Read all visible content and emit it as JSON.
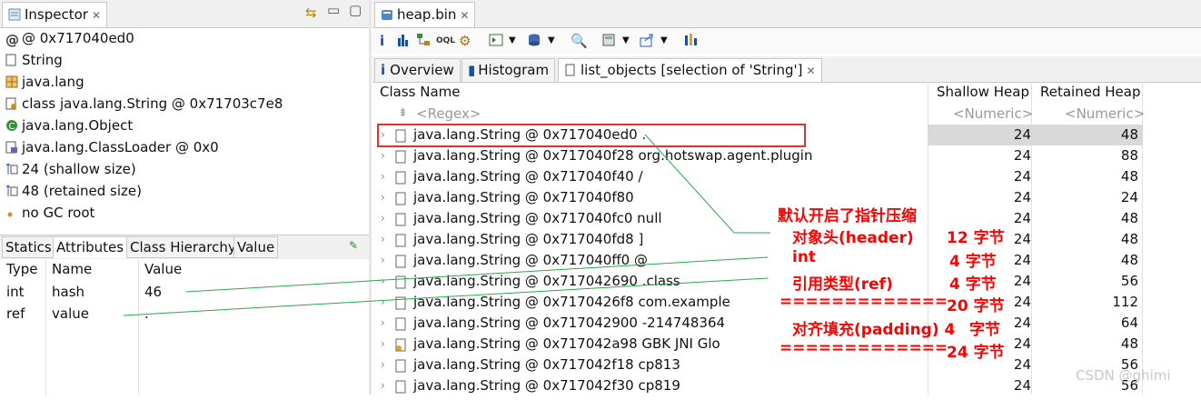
{
  "inspector": {
    "tab_title": "Inspector",
    "rows": [
      {
        "icon": "at-icon",
        "text": "@ 0x717040ed0"
      },
      {
        "icon": "file-icon",
        "text": "String"
      },
      {
        "icon": "package-icon",
        "text": "java.lang"
      },
      {
        "icon": "class-icon",
        "text": "class java.lang.String @ 0x71703c7e8"
      },
      {
        "icon": "superclass-icon",
        "text": "java.lang.Object"
      },
      {
        "icon": "classloader-icon",
        "text": "java.lang.ClassLoader @ 0x0"
      },
      {
        "icon": "size-icon",
        "text": "24 (shallow size)"
      },
      {
        "icon": "size-icon",
        "text": "48 (retained size)"
      },
      {
        "icon": "gc-root-icon",
        "text": "no GC root"
      }
    ],
    "bottom_tabs": [
      "Statics",
      "Attributes",
      "Class Hierarchy",
      "Value"
    ],
    "attr_headers": [
      "Type",
      "Name",
      "Value"
    ],
    "attrs": [
      {
        "type": "int",
        "name": "hash",
        "value": "46"
      },
      {
        "type": "ref",
        "name": "value",
        "value": "."
      }
    ]
  },
  "editor": {
    "tab_title": "heap.bin",
    "view_tabs": [
      "Overview",
      "Histogram",
      "list_objects  [selection of 'String']"
    ],
    "columns": [
      "Class Name",
      "Shallow Heap",
      "Retained Heap"
    ],
    "filter": {
      "regex": "<Regex>",
      "numeric1": "<Numeric>",
      "numeric2": "<Numeric>"
    },
    "rows": [
      {
        "name": "java.lang.String @ 0x717040ed0  .",
        "shallow": "24",
        "retained": "48"
      },
      {
        "name": "java.lang.String @ 0x717040f28  org.hotswap.agent.plugin",
        "shallow": "24",
        "retained": "88"
      },
      {
        "name": "java.lang.String @ 0x717040f40  /",
        "shallow": "24",
        "retained": "48"
      },
      {
        "name": "java.lang.String @ 0x717040f80",
        "shallow": "24",
        "retained": "24"
      },
      {
        "name": "java.lang.String @ 0x717040fc0  null",
        "shallow": "24",
        "retained": "48"
      },
      {
        "name": "java.lang.String @ 0x717040fd8  ]",
        "shallow": "24",
        "retained": "48"
      },
      {
        "name": "java.lang.String @ 0x717040ff0  @",
        "shallow": "24",
        "retained": "48"
      },
      {
        "name": "java.lang.String @ 0x717042690  .class",
        "shallow": "24",
        "retained": "56"
      },
      {
        "name": "java.lang.String @ 0x7170426f8  com.example",
        "shallow": "24",
        "retained": "112"
      },
      {
        "name": "java.lang.String @ 0x717042900  -214748364",
        "shallow": "24",
        "retained": "64"
      },
      {
        "name": "java.lang.String @ 0x717042a98  GBK JNI Glo",
        "shallow": "24",
        "retained": "48"
      },
      {
        "name": "java.lang.String @ 0x717042f18  cp813",
        "shallow": "24",
        "retained": "56"
      },
      {
        "name": "java.lang.String @ 0x717042f30  cp819",
        "shallow": "24",
        "retained": "56"
      }
    ]
  },
  "annotation": {
    "title": "默认开启了指针压缩",
    "lines": [
      {
        "label": "对象头(header)",
        "value": "12 字节"
      },
      {
        "label": "int",
        "value": "4  字节"
      },
      {
        "label": "引用类型(ref)",
        "value": "4  字节"
      },
      {
        "label": "=============",
        "value": "20 字节"
      },
      {
        "label": "对齐填充(padding) 4",
        "value": "字节"
      },
      {
        "label": "=============",
        "value": "24 字节"
      }
    ]
  },
  "watermark": "CSDN @ghimi",
  "colors": {
    "annotation": "#ff0000",
    "highlight": "#e03030",
    "selected_row": "#d9d9d9",
    "lines": "#2aa84a"
  }
}
